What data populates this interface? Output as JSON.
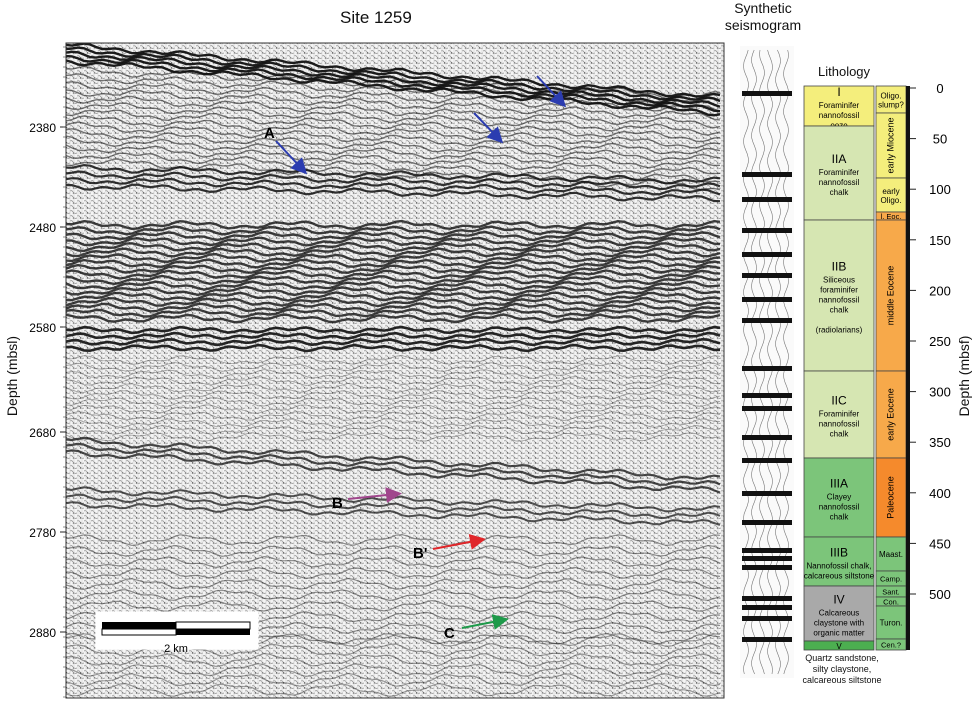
{
  "title": "Site 1259",
  "synthetic_label_line1": "Synthetic",
  "synthetic_label_line2": "seismogram",
  "lithology_label": "Lithology",
  "left_axis": {
    "label": "Depth (mbsl)",
    "ticks": [
      "2380",
      "2480",
      "2580",
      "2680",
      "2780",
      "2880"
    ]
  },
  "right_axis": {
    "label": "Depth (mbsf)",
    "ticks": [
      "0",
      "50",
      "100",
      "150",
      "200",
      "250",
      "300",
      "350",
      "400",
      "450",
      "500"
    ]
  },
  "scale_bar_label": "2 km",
  "reflector_labels": {
    "A": "A",
    "B": "B",
    "B_prime": "B'",
    "C": "C"
  },
  "units": [
    {
      "code": "I",
      "lines": [
        "Foraminifer",
        "nannofossil",
        "ooze"
      ],
      "color": "#f4ee7c"
    },
    {
      "code": "IIA",
      "lines": [
        "Foraminifer",
        "nannofossil",
        "chalk"
      ],
      "color": "#d6e6b2"
    },
    {
      "code": "IIB",
      "lines": [
        "Siliceous",
        "foraminifer",
        "nannofossil",
        "chalk",
        "",
        "(radiolarians)"
      ],
      "color": "#d6e6b2"
    },
    {
      "code": "IIC",
      "lines": [
        "Foraminifer",
        "nannofossil",
        "chalk"
      ],
      "color": "#d6e6b2"
    },
    {
      "code": "IIIA",
      "lines": [
        "Clayey",
        "nannofossil",
        "chalk"
      ],
      "color": "#7cc57a"
    },
    {
      "code": "IIIB",
      "lines": [
        "Nannofossil chalk,",
        "calcareous siltstone"
      ],
      "color": "#7cc57a"
    },
    {
      "code": "IV",
      "lines": [
        "Calcareous",
        "claystone with",
        "organic matter"
      ],
      "color": "#a9a9a9"
    },
    {
      "code": "V",
      "lines": [],
      "color": "#4caf50"
    }
  ],
  "bottom_unit_note": [
    "Quartz sandstone,",
    "silty claystone,",
    "calcareous siltstone"
  ],
  "ages": [
    {
      "label": "Oligo. slump?",
      "color": "#f4ee7c"
    },
    {
      "label": "early Miocene",
      "color": "#f4ee7c"
    },
    {
      "label": "early Oligo.",
      "color": "#f4ee7c"
    },
    {
      "label": "l. Eoc.",
      "color": "#f7a94a"
    },
    {
      "label": "middle Eocene",
      "color": "#f7a94a"
    },
    {
      "label": "early Eocene",
      "color": "#f7a94a"
    },
    {
      "label": "Paleocene",
      "color": "#f58a2c"
    },
    {
      "label": "Maast.",
      "color": "#7cc57a"
    },
    {
      "label": "Camp.",
      "color": "#7cc57a"
    },
    {
      "label": "Sant.",
      "color": "#7cc57a"
    },
    {
      "label": "Con.",
      "color": "#7cc57a"
    },
    {
      "label": "Turon.",
      "color": "#7cc57a"
    },
    {
      "label": "Cen.?",
      "color": "#7cc57a"
    }
  ],
  "arrow_colors": {
    "A": "#2b3cb0",
    "B": "#a0468c",
    "B_prime": "#e0262a",
    "C": "#1e9a4a"
  }
}
